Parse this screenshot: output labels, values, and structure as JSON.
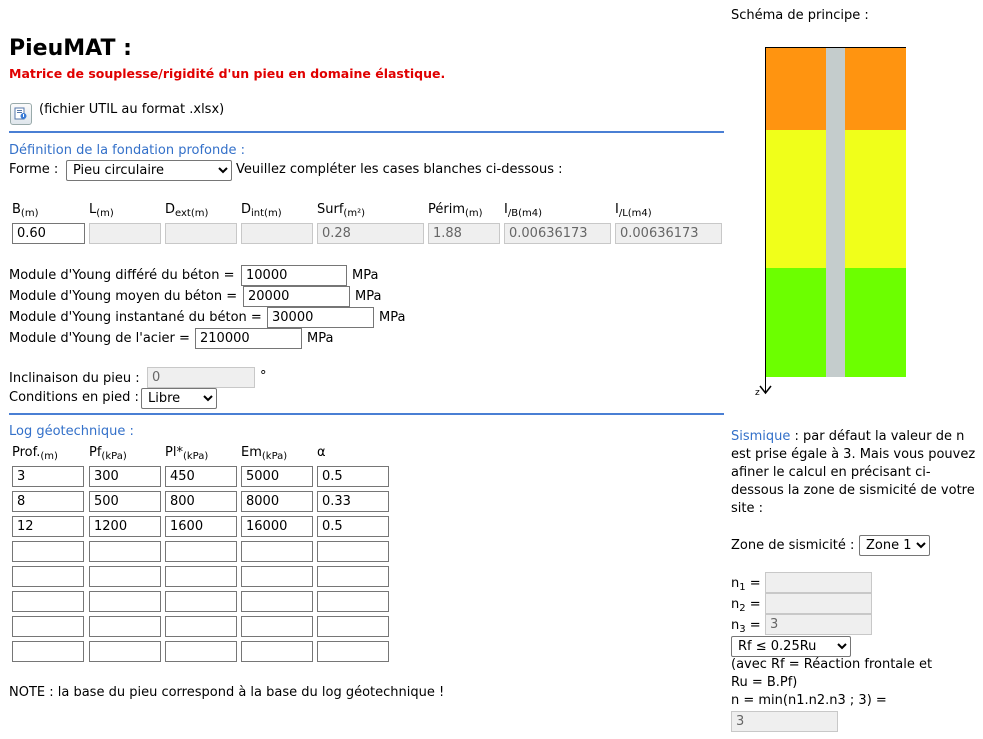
{
  "header": {
    "title": "PieuMAT :",
    "subtitle": "Matrice de souplesse/rigidité d'un pieu en domaine élastique.",
    "util_text": "(fichier UTIL au format .xlsx)"
  },
  "fondation": {
    "section_title": "Définition de la fondation profonde :",
    "forme_label": "Forme :",
    "forme_selected": "Pieu circulaire",
    "instructions": "Veuillez compléter les cases blanches ci-dessous :",
    "params": [
      {
        "label": "B",
        "sub": "(m)",
        "value": "0.60",
        "readonly": false
      },
      {
        "label": "L",
        "sub": "(m)",
        "value": "",
        "readonly": true
      },
      {
        "label": "D",
        "sub": "ext(m)",
        "value": "",
        "readonly": true
      },
      {
        "label": "D",
        "sub": "int(m)",
        "value": "",
        "readonly": true
      },
      {
        "label": "Surf",
        "sub": "(m²)",
        "value": "0.28",
        "readonly": true
      },
      {
        "label": "Périm",
        "sub": "(m)",
        "value": "1.88",
        "readonly": true
      },
      {
        "label": "I",
        "sub": "/B(m4)",
        "value": "0.00636173",
        "readonly": true
      },
      {
        "label": "I",
        "sub": "/L(m4)",
        "value": "0.00636173",
        "readonly": true
      }
    ]
  },
  "modules": [
    {
      "label": "Module d'Young différé du béton =",
      "value": "10000",
      "unit": "MPa"
    },
    {
      "label": "Module d'Young moyen du béton =",
      "value": "20000",
      "unit": "MPa"
    },
    {
      "label": "Module d'Young instantané du béton =",
      "value": "30000",
      "unit": "MPa"
    },
    {
      "label": "Module d'Young de l'acier =",
      "value": "210000",
      "unit": "MPa"
    }
  ],
  "inclinaison": {
    "label": "Inclinaison du pieu :",
    "value": "0",
    "unit": "°"
  },
  "conditions": {
    "label": "Conditions en pied :",
    "selected": "Libre"
  },
  "log": {
    "section_title": "Log géotechnique :",
    "columns": [
      {
        "label": "Prof.",
        "sub": "(m)"
      },
      {
        "label": "Pf",
        "sub": "(kPa)"
      },
      {
        "label": "Pl*",
        "sub": "(kPa)"
      },
      {
        "label": "Em",
        "sub": "(kPa)"
      },
      {
        "label": "α",
        "sub": ""
      }
    ],
    "rows": [
      [
        "3",
        "300",
        "450",
        "5000",
        "0.5"
      ],
      [
        "8",
        "500",
        "800",
        "8000",
        "0.33"
      ],
      [
        "12",
        "1200",
        "1600",
        "16000",
        "0.5"
      ],
      [
        "",
        "",
        "",
        "",
        ""
      ],
      [
        "",
        "",
        "",
        "",
        ""
      ],
      [
        "",
        "",
        "",
        "",
        ""
      ],
      [
        "",
        "",
        "",
        "",
        ""
      ],
      [
        "",
        "",
        "",
        "",
        ""
      ]
    ],
    "note": "NOTE : la base du pieu correspond à la base du log géotechnique !"
  },
  "schema": {
    "title": "Schéma de principe :",
    "axis_label": "z",
    "colors": {
      "layer1": "#ff9410",
      "layer2": "#f0ff1a",
      "layer3": "#6cff00",
      "pile": "#c4cccc"
    }
  },
  "sismique": {
    "title": "Sismique",
    "text_lines": [
      " : par défaut la valeur de n",
      "est prise égale à 3. Mais vous pouvez",
      "afiner le calcul en précisant ci-",
      "dessous la zone de sismicité de votre",
      "site :"
    ],
    "zone_label": "Zone de sismicité :",
    "zone_selected": "Zone 1",
    "n1_label": "n",
    "n1_sub": "1",
    "n1_value": "",
    "n2_label": "n",
    "n2_sub": "2",
    "n2_value": "",
    "n3_label": "n",
    "n3_sub": "3",
    "n3_value": "3",
    "eq": "=",
    "rf_selected": "Rf ≤ 0.25Ru",
    "avec_line1": "(avec Rf = Réaction frontale et",
    "avec_line2": "Ru = B.Pf)",
    "n_formula": "n = min(n1.n2.n3 ; 3) =",
    "n_value": "3"
  }
}
